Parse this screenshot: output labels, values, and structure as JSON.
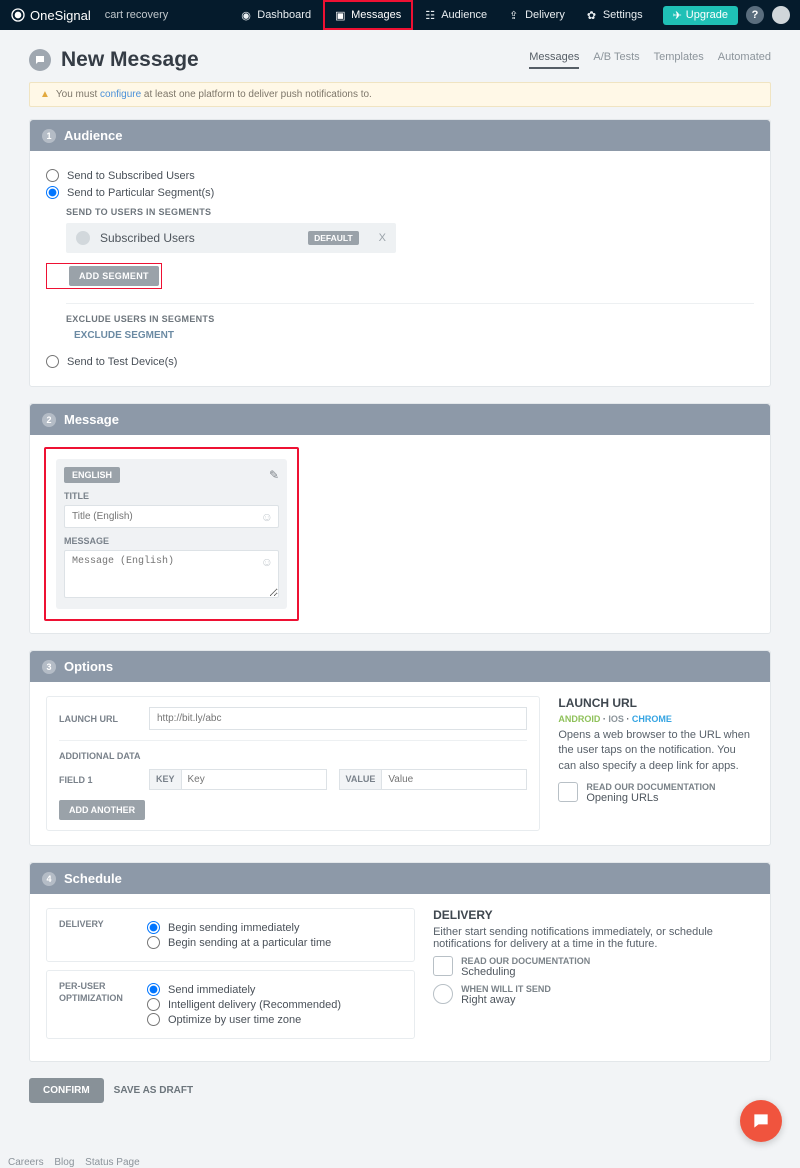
{
  "brand": "OneSignal",
  "app_name": "cart recovery",
  "nav": {
    "dashboard": "Dashboard",
    "messages": "Messages",
    "audience": "Audience",
    "delivery": "Delivery",
    "settings": "Settings"
  },
  "upgrade_label": "Upgrade",
  "page_title": "New Message",
  "tabs": {
    "messages": "Messages",
    "ab": "A/B Tests",
    "templates": "Templates",
    "automated": "Automated"
  },
  "alert": {
    "prefix": "You must ",
    "link": "configure",
    "suffix": " at least one platform to deliver push notifications to."
  },
  "audience": {
    "heading": "Audience",
    "step": "1",
    "subscribed": "Send to Subscribed Users",
    "particular": "Send to Particular Segment(s)",
    "send_segments_label": "SEND TO USERS IN SEGMENTS",
    "segment_name": "Subscribed Users",
    "default_badge": "DEFAULT",
    "close_x": "X",
    "add_segment": "ADD SEGMENT",
    "exclude_label": "EXCLUDE USERS IN SEGMENTS",
    "exclude_link": "EXCLUDE SEGMENT",
    "test_devices": "Send to Test Device(s)"
  },
  "message": {
    "heading": "Message",
    "step": "2",
    "lang_badge": "ENGLISH",
    "title_label": "TITLE",
    "title_placeholder": "Title (English)",
    "msg_label": "MESSAGE",
    "msg_placeholder": "Message (English)"
  },
  "options": {
    "heading": "Options",
    "step": "3",
    "launch_label": "LAUNCH URL",
    "launch_placeholder": "http://bit.ly/abc",
    "add_data_label": "ADDITIONAL DATA",
    "field1": "FIELD 1",
    "key_tag": "KEY",
    "key_placeholder": "Key",
    "value_tag": "VALUE",
    "value_placeholder": "Value",
    "add_another": "ADD ANOTHER",
    "side_title": "LAUNCH URL",
    "pf_android": "ANDROID",
    "pf_ios": "IOS",
    "pf_chrome": "CHROME",
    "side_desc": "Opens a web browser to the URL when the user taps on the notification. You can also specify a deep link for apps.",
    "doc_label": "READ OUR DOCUMENTATION",
    "doc_link": "Opening URLs"
  },
  "schedule": {
    "heading": "Schedule",
    "step": "4",
    "delivery_label": "DELIVERY",
    "d1": "Begin sending immediately",
    "d2": "Begin sending at a particular time",
    "peruser_label": "PER-USER OPTIMIZATION",
    "p1": "Send immediately",
    "p2": "Intelligent delivery (Recommended)",
    "p3": "Optimize by user time zone",
    "side_title": "DELIVERY",
    "side_desc": "Either start sending notifications immediately, or schedule notifications for delivery at a time in the future.",
    "doc_label": "READ OUR DOCUMENTATION",
    "doc_link": "Scheduling",
    "when_label": "WHEN WILL IT SEND",
    "when_val": "Right away"
  },
  "actions": {
    "confirm": "CONFIRM",
    "draft": "SAVE AS DRAFT"
  },
  "footer": {
    "careers": "Careers",
    "blog": "Blog",
    "status": "Status Page"
  }
}
